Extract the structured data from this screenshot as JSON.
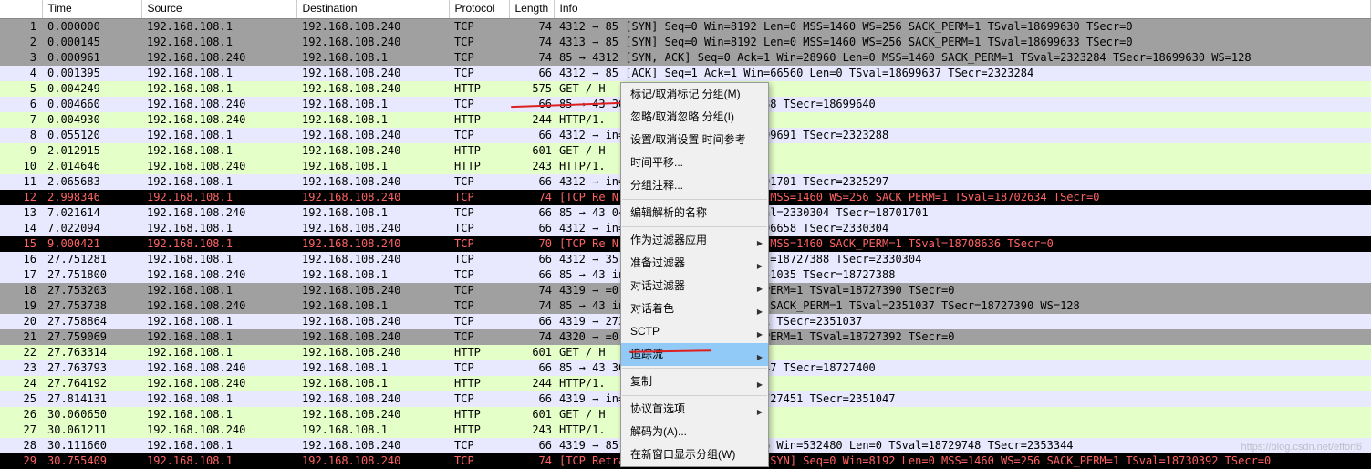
{
  "headers": {
    "no": "",
    "time": "Time",
    "source": "Source",
    "dest": "Destination",
    "protocol": "Protocol",
    "length": "Length",
    "info": "Info"
  },
  "rows": [
    {
      "no": "1",
      "time": "0.000000",
      "source": "192.168.108.1",
      "dest": "192.168.108.240",
      "proto": "TCP",
      "len": "74",
      "info": "4312 → 85 [SYN] Seq=0 Win=8192 Len=0 MSS=1460 WS=256 SACK_PERM=1 TSval=18699630 TSecr=0",
      "class": "bg-tcp-gray"
    },
    {
      "no": "2",
      "time": "0.000145",
      "source": "192.168.108.1",
      "dest": "192.168.108.240",
      "proto": "TCP",
      "len": "74",
      "info": "4313 → 85 [SYN] Seq=0 Win=8192 Len=0 MSS=1460 WS=256 SACK_PERM=1 TSval=18699633 TSecr=0",
      "class": "bg-tcp-gray"
    },
    {
      "no": "3",
      "time": "0.000961",
      "source": "192.168.108.240",
      "dest": "192.168.108.1",
      "proto": "TCP",
      "len": "74",
      "info": "85 → 4312 [SYN, ACK] Seq=0 Ack=1 Win=28960 Len=0 MSS=1460 SACK_PERM=1 TSval=2323284 TSecr=18699630 WS=128",
      "class": "bg-tcp-gray"
    },
    {
      "no": "4",
      "time": "0.001395",
      "source": "192.168.108.1",
      "dest": "192.168.108.240",
      "proto": "TCP",
      "len": "66",
      "info": "4312 → 85 [ACK] Seq=1 Ack=1 Win=66560 Len=0 TSval=18699637 TSecr=2323284",
      "class": "bg-tcp-light"
    },
    {
      "no": "5",
      "time": "0.004249",
      "source": "192.168.108.1",
      "dest": "192.168.108.240",
      "proto": "HTTP",
      "len": "575",
      "info": "GET / H",
      "class": "bg-http"
    },
    {
      "no": "6",
      "time": "0.004660",
      "source": "192.168.108.240",
      "dest": "192.168.108.1",
      "proto": "TCP",
      "len": "66",
      "info": "85 → 43                     30080 Len=0 TSval=2323288 TSecr=18699640",
      "class": "bg-tcp-light"
    },
    {
      "no": "7",
      "time": "0.004930",
      "source": "192.168.108.240",
      "dest": "192.168.108.1",
      "proto": "HTTP",
      "len": "244",
      "info": "HTTP/1.",
      "class": "bg-http"
    },
    {
      "no": "8",
      "time": "0.055120",
      "source": "192.168.108.1",
      "dest": "192.168.108.240",
      "proto": "TCP",
      "len": "66",
      "info": "4312 →                      in=66304 Len=0 TSval=18699691 TSecr=2323288",
      "class": "bg-tcp-light"
    },
    {
      "no": "9",
      "time": "2.012915",
      "source": "192.168.108.1",
      "dest": "192.168.108.240",
      "proto": "HTTP",
      "len": "601",
      "info": "GET / H",
      "class": "bg-http"
    },
    {
      "no": "10",
      "time": "2.014646",
      "source": "192.168.108.240",
      "dest": "192.168.108.1",
      "proto": "HTTP",
      "len": "243",
      "info": "HTTP/1.",
      "class": "bg-http"
    },
    {
      "no": "11",
      "time": "2.065683",
      "source": "192.168.108.1",
      "dest": "192.168.108.240",
      "proto": "TCP",
      "len": "66",
      "info": "4312 →                      in=66048 Len=0 TSval=18701701 TSecr=2325297",
      "class": "bg-tcp-light"
    },
    {
      "no": "12",
      "time": "2.998346",
      "source": "192.168.108.1",
      "dest": "192.168.108.240",
      "proto": "TCP",
      "len": "74",
      "info": "[TCP Re                     N] Seq=0 Win=8192 Len=0 MSS=1460 WS=256 SACK_PERM=1 TSval=18702634 TSecr=0",
      "class": "bg-retrans"
    },
    {
      "no": "13",
      "time": "7.021614",
      "source": "192.168.108.240",
      "dest": "192.168.108.1",
      "proto": "TCP",
      "len": "66",
      "info": "85 → 43                     045 Win=31104 Len=0 TSval=2330304 TSecr=18701701",
      "class": "bg-tcp-light"
    },
    {
      "no": "14",
      "time": "7.022094",
      "source": "192.168.108.1",
      "dest": "192.168.108.240",
      "proto": "TCP",
      "len": "66",
      "info": "4312 →                      in=66048 Len=0 TSval=18706658 TSecr=2330304",
      "class": "bg-tcp-light"
    },
    {
      "no": "15",
      "time": "9.000421",
      "source": "192.168.108.1",
      "dest": "192.168.108.240",
      "proto": "TCP",
      "len": "70",
      "info": "[TCP Re                     N] Seq=0 Win=8192 Len=0 MSS=1460 SACK_PERM=1 TSval=18708636 TSecr=0",
      "class": "bg-retrans"
    },
    {
      "no": "16",
      "time": "27.751281",
      "source": "192.168.108.1",
      "dest": "192.168.108.240",
      "proto": "TCP",
      "len": "66",
      "info": "4312 →                      357 Win=66048 Len=0 TSval=18727388 TSecr=2330304",
      "class": "bg-tcp-light"
    },
    {
      "no": "17",
      "time": "27.751800",
      "source": "192.168.108.240",
      "dest": "192.168.108.1",
      "proto": "TCP",
      "len": "66",
      "info": "85 → 43                     in=31104 Len=0 TSval=2351035 TSecr=18727388",
      "class": "bg-tcp-light"
    },
    {
      "no": "18",
      "time": "27.753203",
      "source": "192.168.108.1",
      "dest": "192.168.108.240",
      "proto": "TCP",
      "len": "74",
      "info": "4319 →                      =0 MSS=1460 WS=256 SACK_PERM=1 TSval=18727390 TSecr=0",
      "class": "bg-tcp-gray"
    },
    {
      "no": "19",
      "time": "27.753738",
      "source": "192.168.108.240",
      "dest": "192.168.108.1",
      "proto": "TCP",
      "len": "74",
      "info": "85 → 43                     in=28960 Len=0 MSS=1460 SACK_PERM=1 TSval=2351037 TSecr=18727390 WS=128",
      "class": "bg-tcp-gray"
    },
    {
      "no": "20",
      "time": "27.758864",
      "source": "192.168.108.1",
      "dest": "192.168.108.240",
      "proto": "TCP",
      "len": "66",
      "info": "4319 →                      2736 Len=0 TSval=18727391 TSecr=2351037",
      "class": "bg-tcp-light"
    },
    {
      "no": "21",
      "time": "27.759069",
      "source": "192.168.108.1",
      "dest": "192.168.108.240",
      "proto": "TCP",
      "len": "74",
      "info": "4320 →                      =0 MSS=1460 WS=256 SACK_PERM=1 TSval=18727392 TSecr=0",
      "class": "bg-tcp-gray"
    },
    {
      "no": "22",
      "time": "27.763314",
      "source": "192.168.108.1",
      "dest": "192.168.108.240",
      "proto": "HTTP",
      "len": "601",
      "info": "GET / H",
      "class": "bg-http"
    },
    {
      "no": "23",
      "time": "27.763793",
      "source": "192.168.108.240",
      "dest": "192.168.108.1",
      "proto": "TCP",
      "len": "66",
      "info": "85 → 43                     30080 Len=0 TSval=2351047 TSecr=18727400",
      "class": "bg-tcp-light"
    },
    {
      "no": "24",
      "time": "27.764192",
      "source": "192.168.108.240",
      "dest": "192.168.108.1",
      "proto": "HTTP",
      "len": "244",
      "info": "HTTP/1.",
      "class": "bg-http"
    },
    {
      "no": "25",
      "time": "27.814131",
      "source": "192.168.108.1",
      "dest": "192.168.108.240",
      "proto": "TCP",
      "len": "66",
      "info": "4319 →                      in=532480 Len=0 TSval=18727451 TSecr=2351047",
      "class": "bg-tcp-light"
    },
    {
      "no": "26",
      "time": "30.060650",
      "source": "192.168.108.1",
      "dest": "192.168.108.240",
      "proto": "HTTP",
      "len": "601",
      "info": "GET / H",
      "class": "bg-http"
    },
    {
      "no": "27",
      "time": "30.061211",
      "source": "192.168.108.240",
      "dest": "192.168.108.1",
      "proto": "HTTP",
      "len": "243",
      "info": "HTTP/1.",
      "class": "bg-http"
    },
    {
      "no": "28",
      "time": "30.111660",
      "source": "192.168.108.1",
      "dest": "192.168.108.240",
      "proto": "TCP",
      "len": "66",
      "info": "4319 → 85 [ACK] Seq=1071 Ack=356 Win=532480 Len=0 TSval=18729748 TSecr=2353344",
      "class": "bg-tcp-light"
    },
    {
      "no": "29",
      "time": "30.755409",
      "source": "192.168.108.1",
      "dest": "192.168.108.240",
      "proto": "TCP",
      "len": "74",
      "info": "[TCP Retransmission] 4320 → 85 [SYN] Seq=0 Win=8192 Len=0 MSS=1460 WS=256 SACK_PERM=1 TSval=18730392 TSecr=0",
      "class": "bg-retrans"
    }
  ],
  "menu": {
    "mark": "标记/取消标记 分组(M)",
    "ignore": "忽略/取消忽略 分组(I)",
    "timeRef": "设置/取消设置 时间参考",
    "timeShift": "时间平移...",
    "comment": "分组注释...",
    "editNames": "编辑解析的名称",
    "applyFilter": "作为过滤器应用",
    "prepFilter": "准备过滤器",
    "convFilter": "对话过滤器",
    "convColor": "对话着色",
    "sctp": "SCTP",
    "follow": "追踪流",
    "copy": "复制",
    "protoPrefs": "协议首选项",
    "decodeAs": "解码为(A)...",
    "showNewWindow": "在新窗口显示分组(W)"
  },
  "watermark": "https://blog.csdn.net/effort6"
}
